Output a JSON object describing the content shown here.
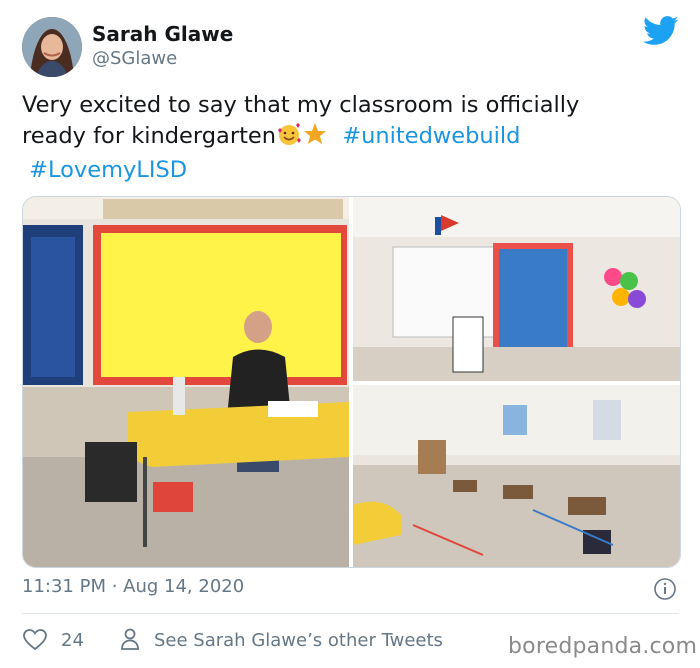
{
  "author": {
    "name": "Sarah Glawe",
    "handle": "@SGlawe"
  },
  "tweet": {
    "text_line1": "Very excited to say that my classroom is officially",
    "text_line2_start": "ready for kindergarten",
    "hashtag1": "#unitedwebuild",
    "hashtag2": "#LovemyLISD"
  },
  "meta": {
    "timestamp": "11:31 PM · Aug 14, 2020"
  },
  "actions": {
    "like_count": "24",
    "other_tweets": "See Sarah Glawe’s other Tweets"
  },
  "watermark": "boredpanda.com",
  "icons": {
    "bird": "twitter-bird-icon",
    "info": "info-icon",
    "like": "heart-icon",
    "person": "person-icon"
  },
  "colors": {
    "link": "#1b95e0",
    "secondary_text": "#657786",
    "twitter_blue": "#1da1f2"
  }
}
